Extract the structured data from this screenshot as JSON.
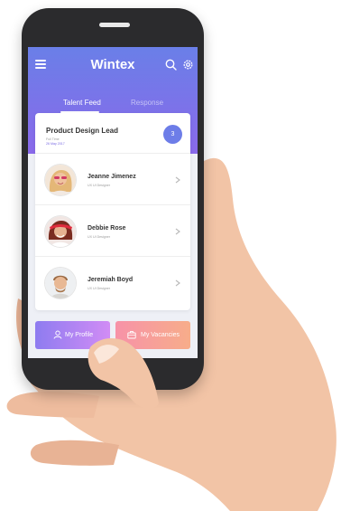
{
  "app": {
    "title": "Wintex"
  },
  "tabs": [
    {
      "label": "Talent Feed",
      "active": true
    },
    {
      "label": "Response",
      "active": false
    }
  ],
  "job": {
    "title": "Product Design Lead",
    "type": "Full Time",
    "date": "26 May 2017",
    "count": "3"
  },
  "candidates": [
    {
      "name": "Jeanne Jimenez",
      "role": "UX UI Designer"
    },
    {
      "name": "Debbie Rose",
      "role": "UX UI Designer"
    },
    {
      "name": "Jeremiah Boyd",
      "role": "UX UI Designer"
    }
  ],
  "bottom_buttons": {
    "profile_label": "My Profile",
    "vacancies_label": "My Vacancies"
  },
  "colors": {
    "header_top": "#6a7fe8",
    "header_bottom": "#8a69ea",
    "badge": "#6d7de8",
    "profile_button": "#8e7cf0",
    "vacancies_button": "#f792a8"
  },
  "icons": [
    "menu-icon",
    "search-icon",
    "gear-icon",
    "chevron-right-icon",
    "user-icon",
    "briefcase-icon"
  ]
}
